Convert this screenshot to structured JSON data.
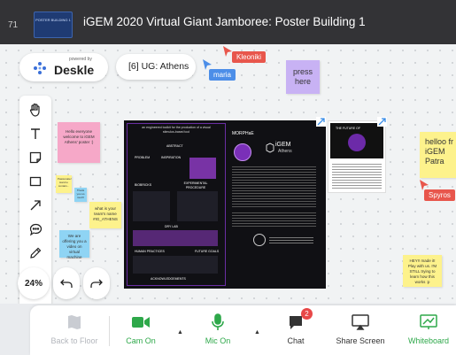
{
  "header": {
    "room_number": "71",
    "logo_text": "POSTER BUILDING 1",
    "title": "iGEM 2020 Virtual Giant Jamboree: Poster Building 1"
  },
  "brand": {
    "powered_by": "powered by",
    "name": "Deskle"
  },
  "room_label": "[6] UG: Athens",
  "cursors": [
    {
      "name": "Kleoniki",
      "color": "#e8564c"
    },
    {
      "name": "maria",
      "color": "#4c8ee8"
    },
    {
      "name": "Spyros",
      "color": "#e8564c"
    }
  ],
  "stickies": {
    "welcome": "Hello everyone welcome to iGEM Athens' poster :)",
    "press_here": "press here",
    "passionate": "Passionate! Hard to contain...",
    "thank_you": "Thank you so much!",
    "team_name": "what is your team's name #IG_ATHENS",
    "we_offer": "We are offering you a video on virtual machine",
    "hello_fr": "helloo fr iGEM Patra",
    "hey": "HEY!! made it! Play with us. I'M STILL trying to learn how this works :p"
  },
  "poster": {
    "headline": "an engineered toolkit for the production of a visual stimulus-based tool",
    "morphae": "MORPHaE",
    "igem": "iGEM",
    "athens": "Athens",
    "sections": [
      "ABSTRACT",
      "PROBLEM",
      "INSPIRATION",
      "BIOBRICKS",
      "EXPERIMENTAL PROCEDURE",
      "DRY LAB",
      "HUMAN PRACTICES",
      "FUTURE GOALS",
      "ACKNOWLEDGEMENTS"
    ],
    "small_title": "THE FUTURE OF"
  },
  "zoom": {
    "level": "24%"
  },
  "bottom": {
    "back": "Back to Floor",
    "cam": "Cam On",
    "mic": "Mic On",
    "chat": "Chat",
    "chat_badge": "2",
    "share": "Share Screen",
    "whiteboard": "Whiteboard"
  },
  "colors": {
    "accent_green": "#2ea84a",
    "badge_red": "#e84848",
    "sticky_pink": "#f6a8c8",
    "sticky_yellow": "#fdf28c",
    "sticky_purple": "#c8b2f4",
    "sticky_blue": "#8fd4f4",
    "poster_purple": "#9b3fd6"
  }
}
